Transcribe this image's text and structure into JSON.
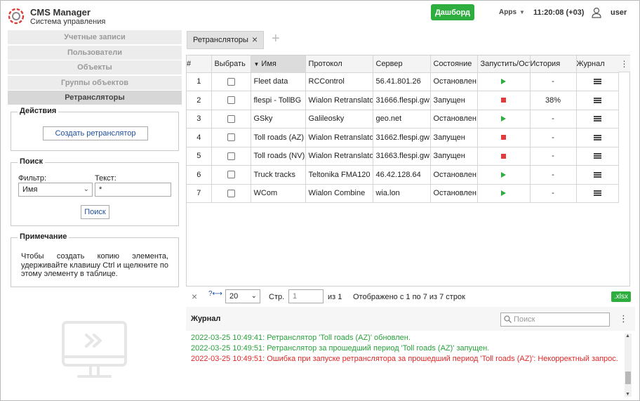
{
  "header": {
    "title": "CMS Manager",
    "subtitle": "Система управления",
    "dashboard_label": "Дашборд",
    "apps_label": "Apps",
    "clock": "11:20:08 (+03)",
    "user": "user"
  },
  "nav": {
    "items": [
      {
        "label": "Учетные записи",
        "active": false
      },
      {
        "label": "Пользователи",
        "active": false
      },
      {
        "label": "Объекты",
        "active": false
      },
      {
        "label": "Группы объектов",
        "active": false
      },
      {
        "label": "Ретрансляторы",
        "active": true
      }
    ]
  },
  "actions": {
    "title": "Действия",
    "create_label": "Создать ретранслятор"
  },
  "search": {
    "title": "Поиск",
    "filter_label": "Фильтр:",
    "text_label": "Текст:",
    "filter_value": "Имя",
    "text_value": "*",
    "button_label": "Поиск"
  },
  "note": {
    "title": "Примечание",
    "text": "Чтобы создать копию элемента, удерживайте клавишу Ctrl и щелкните по этому элементу в таблице."
  },
  "tabs": {
    "active_label": "Ретрансляторы"
  },
  "table": {
    "columns": [
      "#",
      "Выбрать",
      "Имя",
      "Протокол",
      "Сервер",
      "Состояние",
      "Запустить/Остановить",
      "История",
      "Журнал"
    ],
    "rows": [
      {
        "num": "1",
        "name": "Fleet data",
        "protocol": "RCControl",
        "server": "56.41.801.26",
        "state": "Остановлен",
        "action": "play",
        "history": "-"
      },
      {
        "num": "2",
        "name": "flespi - TollBG",
        "protocol": "Wialon Retranslator",
        "server": "31666.flespi.gw",
        "state": "Запущен",
        "action": "stop",
        "history": "38%"
      },
      {
        "num": "3",
        "name": "GSky",
        "protocol": "Galileosky",
        "server": "geo.net",
        "state": "Остановлен",
        "action": "play",
        "history": "-"
      },
      {
        "num": "4",
        "name": "Toll roads (AZ)",
        "protocol": "Wialon Retranslator",
        "server": "31662.flespi.gw",
        "state": "Запущен",
        "action": "stop",
        "history": "-"
      },
      {
        "num": "5",
        "name": "Toll roads (NV)",
        "protocol": "Wialon Retranslator",
        "server": "31663.flespi.gw",
        "state": "Запущен",
        "action": "stop",
        "history": "-"
      },
      {
        "num": "6",
        "name": "Truck tracks",
        "protocol": "Teltonika FMA120",
        "server": "46.42.128.64",
        "state": "Остановлен",
        "action": "play",
        "history": "-"
      },
      {
        "num": "7",
        "name": "WCom",
        "protocol": "Wialon Combine",
        "server": "wia.lon",
        "state": "Остановлен",
        "action": "play",
        "history": "-"
      }
    ]
  },
  "pager": {
    "page_size": "20",
    "page_label": "Стр.",
    "page_value": "1",
    "of_label": "из 1",
    "info": "Отображено с 1 по 7 из 7 строк",
    "export_label": ".xlsx"
  },
  "log": {
    "title": "Журнал",
    "search_placeholder": "Поиск",
    "lines": [
      {
        "text": "2022-03-25 10:49:41: Ретранслятор 'Toll roads (AZ)' обновлен.",
        "level": "ok"
      },
      {
        "text": "2022-03-25 10:49:51: Ретранслятор за прошедший период 'Toll roads (AZ)' запущен.",
        "level": "ok"
      },
      {
        "text": "2022-03-25 10:49:51: Ошибка при запуске ретранслятора за прошедший период 'Toll roads (AZ)': Некорректный запрос.",
        "level": "err"
      }
    ]
  },
  "colors": {
    "accent_green": "#2dae3f",
    "error_red": "#e02828",
    "stop_red": "#e23b3b",
    "link_blue": "#2050a0"
  },
  "icons": {
    "logo": "gear-logo-icon",
    "user": "user-icon",
    "play": "play-icon",
    "stop": "stop-icon",
    "journal": "list-icon",
    "monitor": "monitor-illustration"
  }
}
